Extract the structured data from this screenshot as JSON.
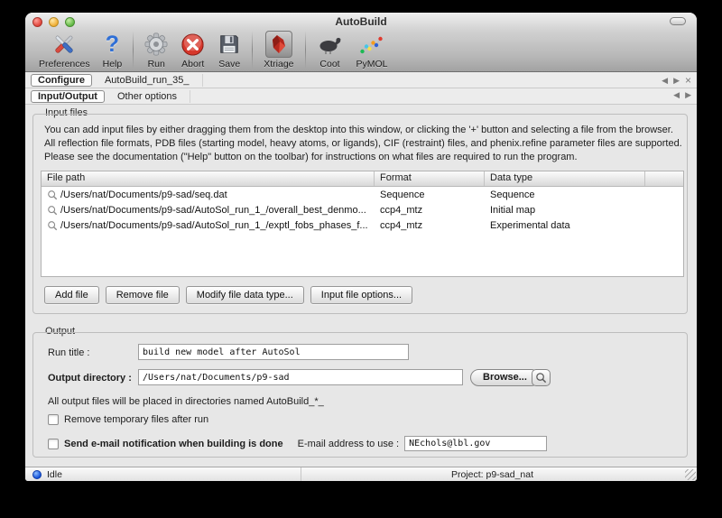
{
  "window": {
    "title": "AutoBuild"
  },
  "toolbar": {
    "items": [
      {
        "label": "Preferences",
        "icon": "preferences-icon"
      },
      {
        "label": "Help",
        "icon": "help-icon",
        "glyph": "?"
      },
      {
        "label": "Run",
        "icon": "run-gear-icon"
      },
      {
        "label": "Abort",
        "icon": "abort-icon"
      },
      {
        "label": "Save",
        "icon": "save-floppy-icon"
      },
      {
        "label": "Xtriage",
        "icon": "xtriage-crystal-icon"
      },
      {
        "label": "Coot",
        "icon": "coot-bird-icon"
      },
      {
        "label": "PyMOL",
        "icon": "pymol-ribbon-icon"
      }
    ]
  },
  "tabs": {
    "main": [
      {
        "label": "Configure",
        "active": true
      },
      {
        "label": "AutoBuild_run_35_",
        "active": false
      }
    ],
    "sub": [
      {
        "label": "Input/Output",
        "active": true
      },
      {
        "label": "Other options",
        "active": false
      }
    ],
    "nav": {
      "prev": "◀",
      "next": "▶",
      "close": "×"
    }
  },
  "input_files": {
    "group_label": "Input files",
    "instructions": "You can add input files by either dragging them from the desktop into this window, or clicking the '+' button and selecting a file from the browser. All reflection file formats, PDB files (starting model, heavy atoms, or ligands), CIF (restraint) files, and phenix.refine parameter files are supported.  Please see the documentation (\"Help\" button on the toolbar) for instructions on what files are required to run the program.",
    "table": {
      "columns": [
        "File path",
        "Format",
        "Data type"
      ],
      "rows": [
        {
          "path": "/Users/nat/Documents/p9-sad/seq.dat",
          "format": "Sequence",
          "type": "Sequence"
        },
        {
          "path": "/Users/nat/Documents/p9-sad/AutoSol_run_1_/overall_best_denmo...",
          "format": "ccp4_mtz",
          "type": "Initial map"
        },
        {
          "path": "/Users/nat/Documents/p9-sad/AutoSol_run_1_/exptl_fobs_phases_f...",
          "format": "ccp4_mtz",
          "type": "Experimental data"
        }
      ]
    },
    "buttons": {
      "add": "Add file",
      "remove": "Remove file",
      "modify": "Modify file data type...",
      "options": "Input file options..."
    }
  },
  "output": {
    "group_label": "Output",
    "run_title_label": "Run title :",
    "run_title_value": "build new model after AutoSol",
    "output_dir_label": "Output directory :",
    "output_dir_value": "/Users/nat/Documents/p9-sad",
    "browse_label": "Browse...",
    "note": "All output files will be placed in directories named AutoBuild_*_",
    "remove_temp_label": "Remove temporary files after run",
    "email_checkbox_label": "Send e-mail notification when building is done",
    "email_field_label": "E-mail address to use :",
    "email_value": "NEchols@lbl.gov"
  },
  "statusbar": {
    "status": "Idle",
    "project": "Project: p9-sad_nat"
  }
}
